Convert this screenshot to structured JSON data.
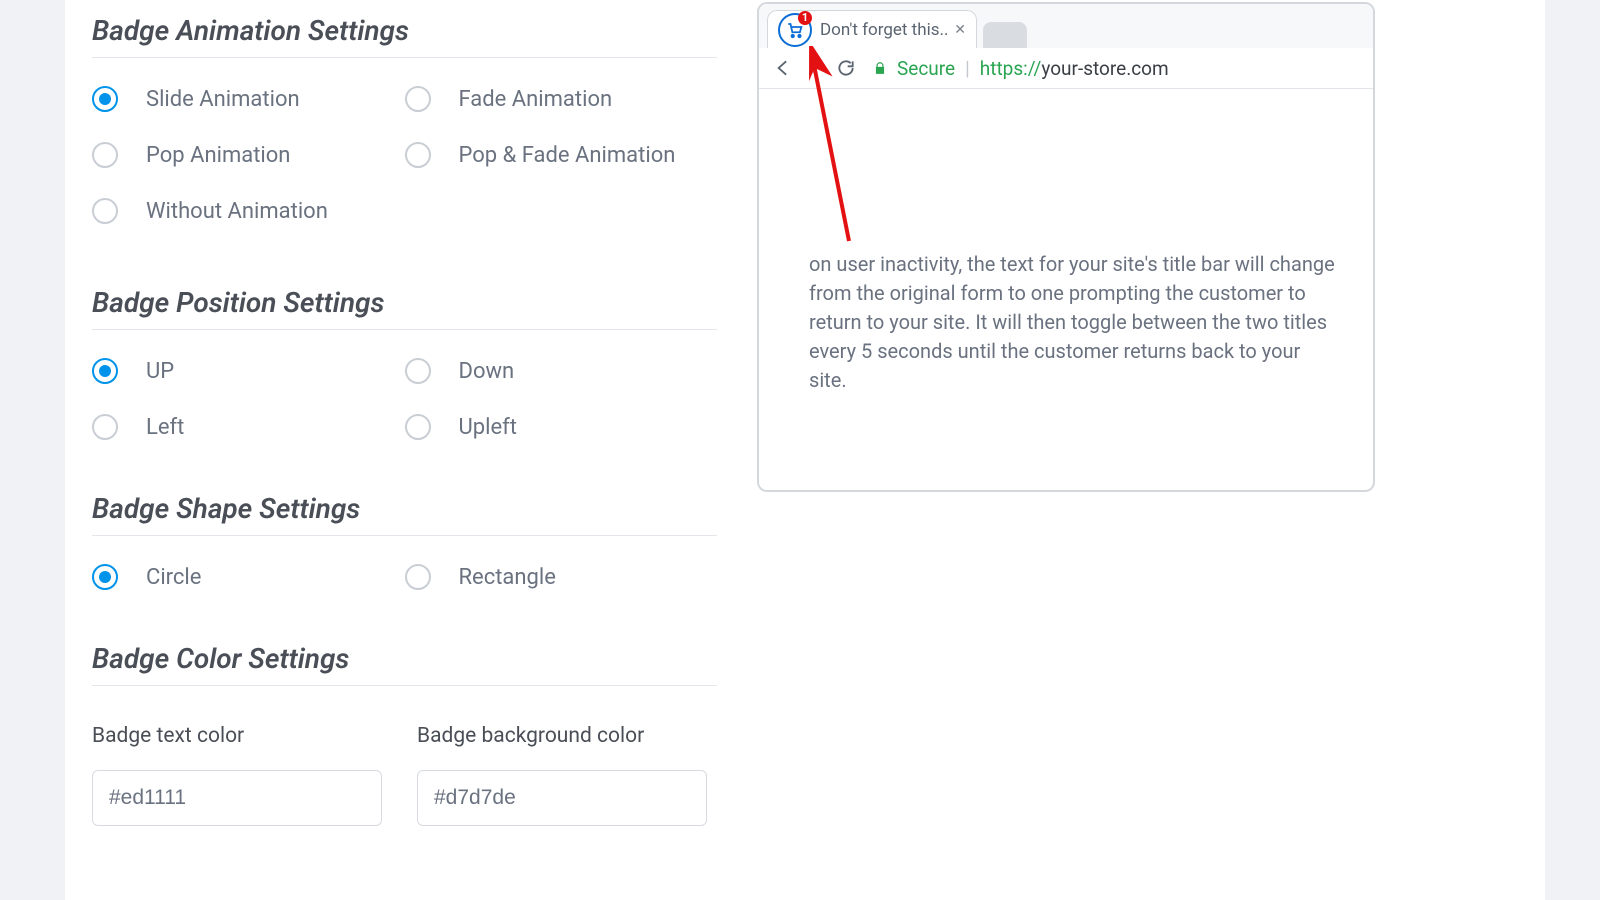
{
  "sections": {
    "animation": {
      "title": "Badge Animation Settings",
      "options": [
        "Slide Animation",
        "Fade Animation",
        "Pop Animation",
        "Pop & Fade Animation",
        "Without Animation"
      ],
      "selected": 0
    },
    "position": {
      "title": "Badge Position Settings",
      "options": [
        "UP",
        "Down",
        "Left",
        "Upleft"
      ],
      "selected": 0
    },
    "shape": {
      "title": "Badge Shape Settings",
      "options": [
        "Circle",
        "Rectangle"
      ],
      "selected": 0
    },
    "color": {
      "title": "Badge Color Settings",
      "text_label": "Badge text color",
      "text_value": "#ed1111",
      "bg_label": "Badge background color",
      "bg_value": "#d7d7de"
    }
  },
  "preview": {
    "tab_title": "Don't forget this..",
    "badge_count": "1",
    "secure_label": "Secure",
    "url_protocol": "https://",
    "url_domain": "your-store.com",
    "description": "on user inactivity, the text for your site's title bar will change from the original form to one prompting the customer to return to your site. It will then toggle between the two titles every 5 seconds until the customer returns back to your site."
  }
}
